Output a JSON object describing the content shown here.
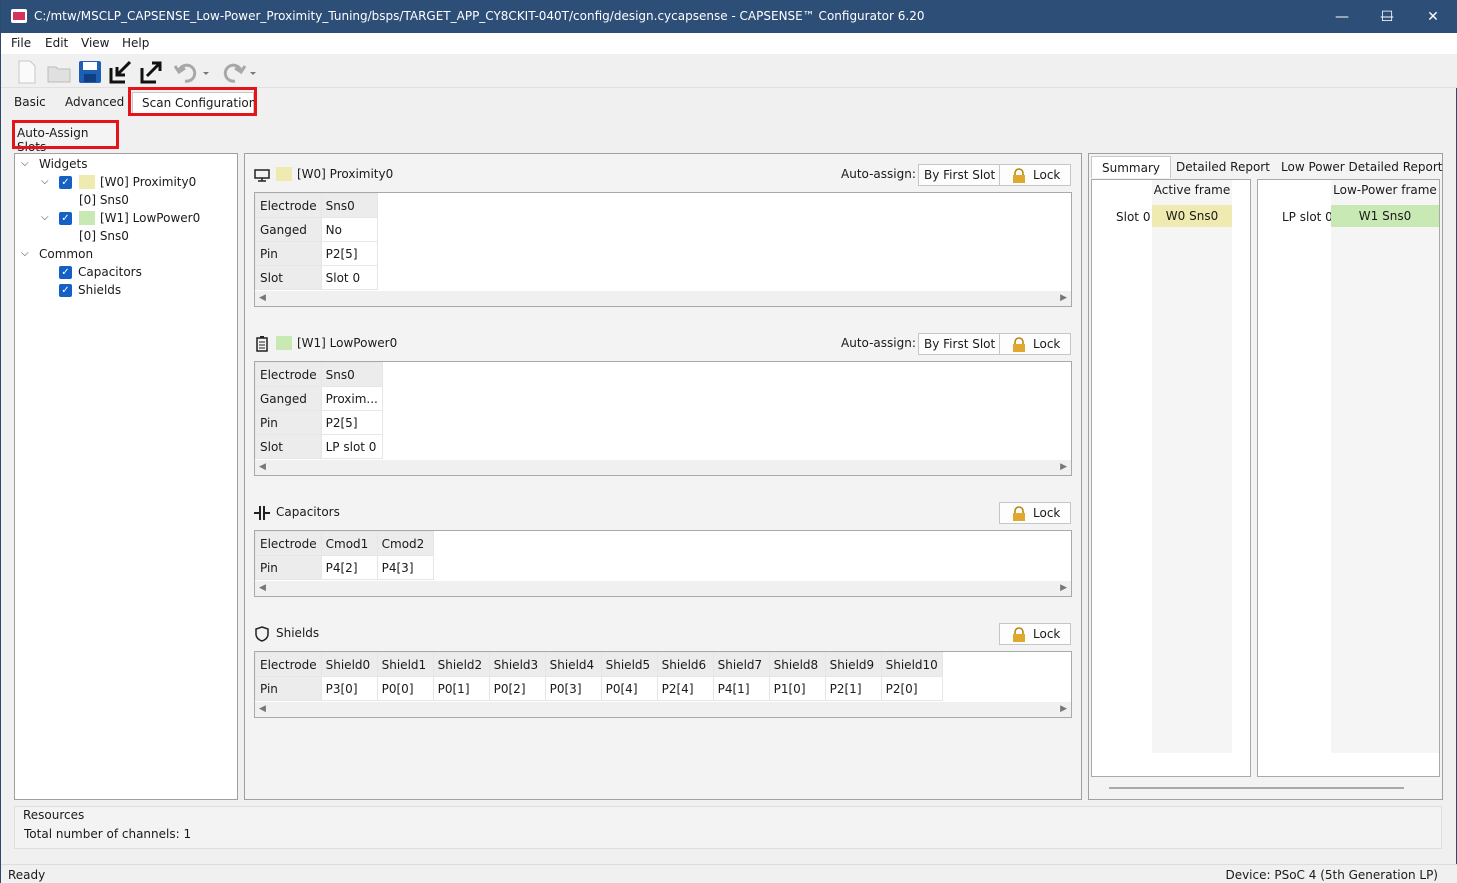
{
  "window": {
    "title": "C:/mtw/MSCLP_CAPSENSE_Low-Power_Proximity_Tuning/bsps/TARGET_APP_CY8CKIT-040T/config/design.cycapsense - CAPSENSE™ Configurator 6.20",
    "minimize": "—",
    "maximize": "☐",
    "close": "✕"
  },
  "menu": [
    "File",
    "Edit",
    "View",
    "Help"
  ],
  "tabs": [
    "Basic",
    "Advanced",
    "Scan Configuration"
  ],
  "auto_assign_slots": "Auto-Assign Slots",
  "tree": {
    "widgets": "Widgets",
    "w0": "[W0] Proximity0",
    "w0_sns": "[0] Sns0",
    "w1": "[W1] LowPower0",
    "w1_sns": "[0] Sns0",
    "common": "Common",
    "capacitors": "Capacitors",
    "shields": "Shields"
  },
  "colors": {
    "proximity": "#eeeab0",
    "lowpower": "#c9e9b4",
    "accent": "#1560c4",
    "highlight_box": "#e4141a",
    "titlebar": "#2d4e76"
  },
  "sections": {
    "proximity": {
      "title": "[W0] Proximity0",
      "auto_assign_label": "Auto-assign:",
      "by_first_slot": "By First Slot",
      "lock": "Lock",
      "rows": [
        [
          "Electrode",
          "Sns0"
        ],
        [
          "Ganged",
          "No"
        ],
        [
          "Pin",
          "P2[5]"
        ],
        [
          "Slot",
          "Slot 0"
        ]
      ]
    },
    "lowpower": {
      "title": "[W1] LowPower0",
      "auto_assign_label": "Auto-assign:",
      "by_first_slot": "By First Slot",
      "lock": "Lock",
      "rows": [
        [
          "Electrode",
          "Sns0"
        ],
        [
          "Ganged",
          "Proxim..."
        ],
        [
          "Pin",
          "P2[5]"
        ],
        [
          "Slot",
          "LP slot 0"
        ]
      ]
    },
    "capacitors": {
      "title": "Capacitors",
      "lock": "Lock",
      "rows": [
        [
          "Electrode",
          "Cmod1",
          "Cmod2"
        ],
        [
          "Pin",
          "P4[2]",
          "P4[3]"
        ]
      ]
    },
    "shields": {
      "title": "Shields",
      "lock": "Lock",
      "rows": [
        [
          "Electrode",
          "Shield0",
          "Shield1",
          "Shield2",
          "Shield3",
          "Shield4",
          "Shield5",
          "Shield6",
          "Shield7",
          "Shield8",
          "Shield9",
          "Shield10"
        ],
        [
          "Pin",
          "P3[0]",
          "P0[0]",
          "P0[1]",
          "P0[2]",
          "P0[3]",
          "P0[4]",
          "P2[4]",
          "P4[1]",
          "P1[0]",
          "P2[1]",
          "P2[0]"
        ]
      ]
    }
  },
  "report": {
    "tabs": [
      "Summary",
      "Detailed Report",
      "Low Power Detailed Report"
    ],
    "active_header": "Active frame",
    "active_slot": "Slot 0",
    "active_value": "W0 Sns0",
    "lp_header": "Low-Power frame",
    "lp_slot": "LP slot 0",
    "lp_value": "W1 Sns0"
  },
  "resources": {
    "title": "Resources",
    "channels": "Total number of channels: 1"
  },
  "status": {
    "left": "Ready",
    "right": "Device: PSoC 4 (5th Generation LP)"
  }
}
